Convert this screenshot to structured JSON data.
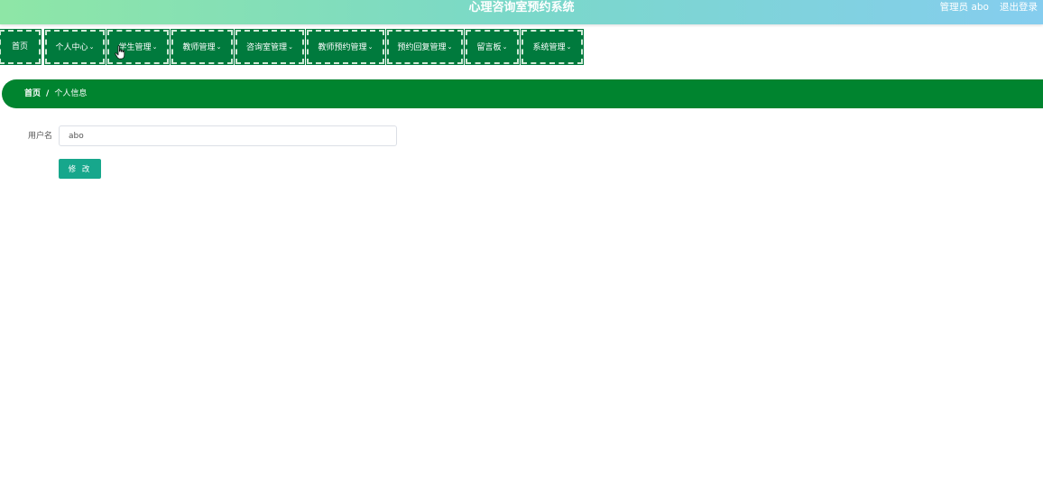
{
  "header": {
    "title": "心理咨询室预约系统",
    "user_text": "管理员 abo",
    "logout_label": "退出登录"
  },
  "nav": [
    {
      "label": "首页",
      "has_dropdown": false
    },
    {
      "label": "个人中心",
      "has_dropdown": true
    },
    {
      "label": "学生管理",
      "has_dropdown": true
    },
    {
      "label": "教师管理",
      "has_dropdown": true
    },
    {
      "label": "咨询室管理",
      "has_dropdown": true
    },
    {
      "label": "教师预约管理",
      "has_dropdown": true
    },
    {
      "label": "预约回复管理",
      "has_dropdown": true
    },
    {
      "label": "留言板",
      "has_dropdown": true
    },
    {
      "label": "系统管理",
      "has_dropdown": true
    }
  ],
  "breadcrumb": {
    "home": "首页",
    "separator": "/",
    "current": "个人信息"
  },
  "form": {
    "username_label": "用户名",
    "username_value": "abo",
    "submit_label": "修 改"
  },
  "colors": {
    "nav_bg": "#007a3d",
    "breadcrumb_bg": "#00842f",
    "button_bg": "#17a78c"
  }
}
